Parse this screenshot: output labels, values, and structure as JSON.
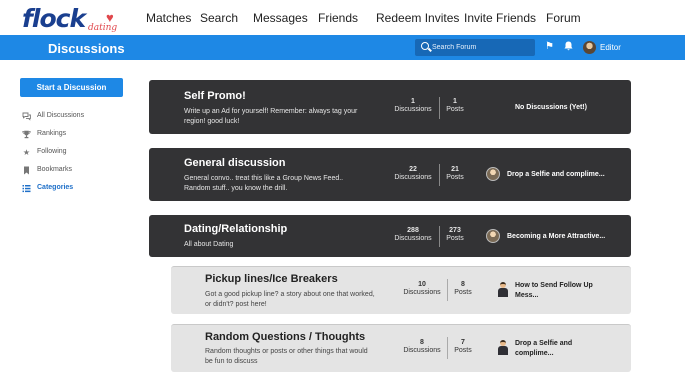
{
  "app": {
    "logo_text": "flock",
    "logo_sub": "dating"
  },
  "nav": {
    "items": [
      "Matches",
      "Search",
      "Messages",
      "Friends",
      "Redeem Invites",
      "Invite Friends",
      "Forum"
    ]
  },
  "header": {
    "title": "Discussions",
    "search_placeholder": "Search Forum",
    "user": "Editor"
  },
  "sidebar": {
    "start_button": "Start a Discussion",
    "items": [
      {
        "label": "All Discussions",
        "icon": "chat-bubbles-icon"
      },
      {
        "label": "Rankings",
        "icon": "trophy-icon"
      },
      {
        "label": "Following",
        "icon": "star-icon"
      },
      {
        "label": "Bookmarks",
        "icon": "bookmark-icon"
      },
      {
        "label": "Categories",
        "icon": "list-icon",
        "active": true
      }
    ]
  },
  "categories": [
    {
      "title": "Self Promo!",
      "desc1": "Write up an Ad for yourself! Remember: always tag your",
      "desc2": "region! good luck!",
      "discussions": "1",
      "posts": "1",
      "disc_label": "Discussions",
      "posts_label": "Posts",
      "latest1": "No Discussions (Yet!)",
      "latest2": ""
    },
    {
      "title": "General discussion",
      "desc1": "General convo.. treat this like a Group News Feed..",
      "desc2": "Random stuff.. you know the drill.",
      "discussions": "22",
      "posts": "21",
      "disc_label": "Discussions",
      "posts_label": "Posts",
      "latest1": "Drop a Selfie and complime...",
      "latest2": ""
    },
    {
      "title": "Dating/Relationship",
      "desc1": "All about Dating",
      "desc2": "",
      "discussions": "288",
      "posts": "273",
      "disc_label": "Discussions",
      "posts_label": "Posts",
      "latest1": "Becoming a More Attractive...",
      "latest2": ""
    },
    {
      "title": "Pickup lines/Ice Breakers",
      "desc1": "Got a good pickup line? a story about one that worked,",
      "desc2": "or didn't? post here!",
      "discussions": "10",
      "posts": "8",
      "disc_label": "Discussions",
      "posts_label": "Posts",
      "latest1": "How to Send Follow Up",
      "latest2": "Mess..."
    },
    {
      "title": "Random Questions / Thoughts",
      "desc1": "Random thoughts or posts or other things that would",
      "desc2": "be fun to discuss",
      "discussions": "8",
      "posts": "7",
      "disc_label": "Discussions",
      "posts_label": "Posts",
      "latest1": "Drop a Selfie and",
      "latest2": "complime..."
    }
  ],
  "colors": {
    "brand_blue": "#1e88e5",
    "logo_navy": "#1a3f8f",
    "logo_red": "#e0474c",
    "card_dark": "#333335",
    "card_light": "#e4e4e4"
  }
}
